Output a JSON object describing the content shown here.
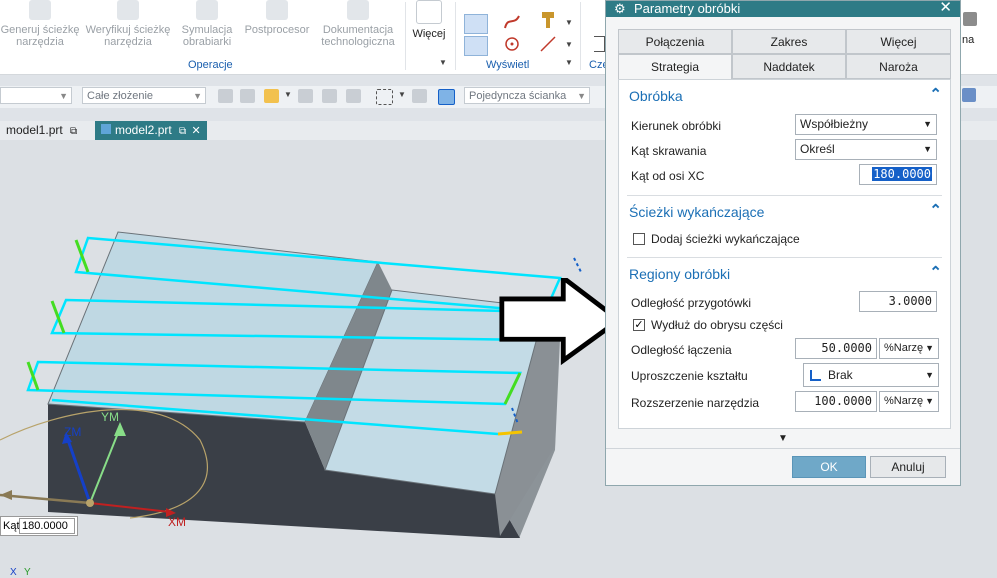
{
  "ribbon": {
    "buttons": [
      {
        "label": "Generuj ścieżkę narzędzia"
      },
      {
        "label": "Weryfikuj ścieżkę narzędzia"
      },
      {
        "label": "Symulacja obrabiarki"
      },
      {
        "label": "Postprocesor"
      },
      {
        "label": "Dokumentacja technologiczna"
      }
    ],
    "more_label": "Więcej",
    "group_operacje": "Operacje",
    "group_wyswietl": "Wyświetl",
    "group_czesc": "Czę",
    "cut_label": "na"
  },
  "toolbar": {
    "assembly_combo": "Całe złożenie",
    "face_combo": "Pojedyncza ścianka"
  },
  "doc_tabs": [
    "model1.prt",
    "model2.prt"
  ],
  "viewport": {
    "axis_ym": "YM",
    "axis_zm": "ZM",
    "axis_xm": "XM",
    "angle_label": "Kąt",
    "angle_value": "180.0000",
    "bottom_x": "X",
    "bottom_y": "Y"
  },
  "dialog": {
    "title": "Parametry obróbki",
    "tabs_row1": [
      "Połączenia",
      "Zakres",
      "Więcej"
    ],
    "tabs_row2": [
      "Strategia",
      "Naddatek",
      "Naroża"
    ],
    "active_tab": "Strategia",
    "sections": {
      "obrobka": {
        "title": "Obróbka",
        "kierunek_label": "Kierunek obróbki",
        "kierunek_value": "Współbieżny",
        "kat_skrawania_label": "Kąt skrawania",
        "kat_skrawania_value": "Określ",
        "kat_od_osi_label": "Kąt od osi XC",
        "kat_od_osi_value": "180.0000"
      },
      "sciezki": {
        "title": "Ścieżki wykańczające",
        "dodaj_label": "Dodaj ścieżki wykańczające",
        "dodaj_checked": false
      },
      "regiony": {
        "title": "Regiony obróbki",
        "przygotowki_label": "Odległość przygotówki",
        "przygotowki_value": "3.0000",
        "wydluz_label": "Wydłuż do obrysu części",
        "wydluz_checked": true,
        "laczenia_label": "Odległość łączenia",
        "laczenia_value": "50.0000",
        "laczenia_unit": "%Narzę",
        "uproszczenie_label": "Uproszczenie kształtu",
        "uproszczenie_value": "Brak",
        "rozszerzenie_label": "Rozszerzenie narzędzia",
        "rozszerzenie_value": "100.0000",
        "rozszerzenie_unit": "%Narzę"
      }
    },
    "ok_label": "OK",
    "cancel_label": "Anuluj"
  },
  "colors": {
    "title_bar": "#2e7b86",
    "section_title": "#1b6fb5",
    "toolpath": "#00e5ff",
    "selection_highlight": "#1560c8",
    "ok_button": "#6fa8c8"
  }
}
